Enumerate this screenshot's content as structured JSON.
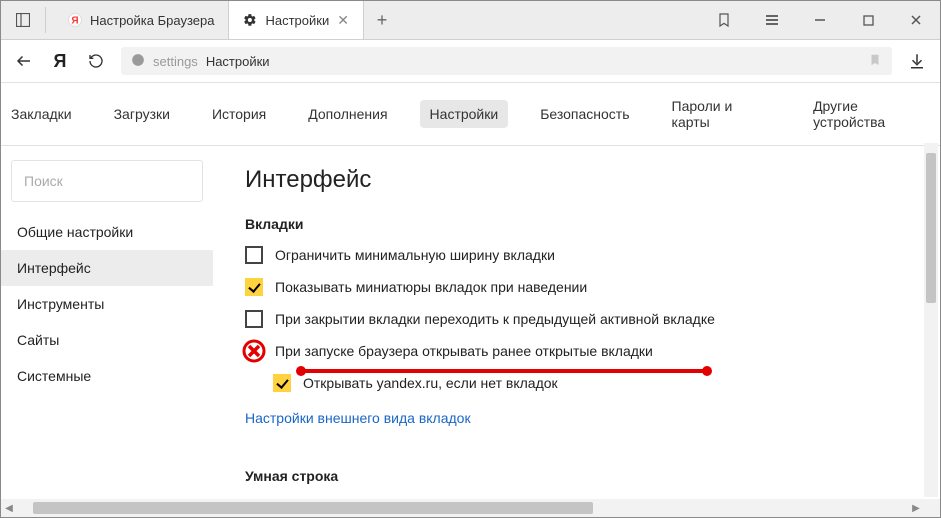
{
  "tabs": {
    "inactive": {
      "title": "Настройка Браузера"
    },
    "active": {
      "title": "Настройки"
    }
  },
  "addressbar": {
    "url_text": "settings",
    "page_title": "Настройки"
  },
  "topnav": {
    "items": [
      "Закладки",
      "Загрузки",
      "История",
      "Дополнения",
      "Настройки",
      "Безопасность",
      "Пароли и карты",
      "Другие устройства"
    ],
    "active_index": 4
  },
  "sidebar": {
    "search_placeholder": "Поиск",
    "items": [
      "Общие настройки",
      "Интерфейс",
      "Инструменты",
      "Сайты",
      "Системные"
    ],
    "active_index": 1
  },
  "content": {
    "heading": "Интерфейс",
    "tabs_section": {
      "title": "Вкладки",
      "options": [
        {
          "label": "Ограничить минимальную ширину вкладки",
          "checked": false
        },
        {
          "label": "Показывать миниатюры вкладок при наведении",
          "checked": true
        },
        {
          "label": "При закрытии вкладки переходить к предыдущей активной вкладке",
          "checked": false
        },
        {
          "label": "При запуске браузера открывать ранее открытые вкладки",
          "checked": false,
          "annotated_cross": true
        },
        {
          "label": "Открывать yandex.ru, если нет вкладок",
          "checked": true,
          "indent": true
        }
      ],
      "appearance_link": "Настройки внешнего вида вкладок"
    },
    "smartline_title": "Умная строка"
  },
  "colors": {
    "accent": "#ffd23f",
    "link": "#1866c7",
    "annotation": "#e30000"
  }
}
